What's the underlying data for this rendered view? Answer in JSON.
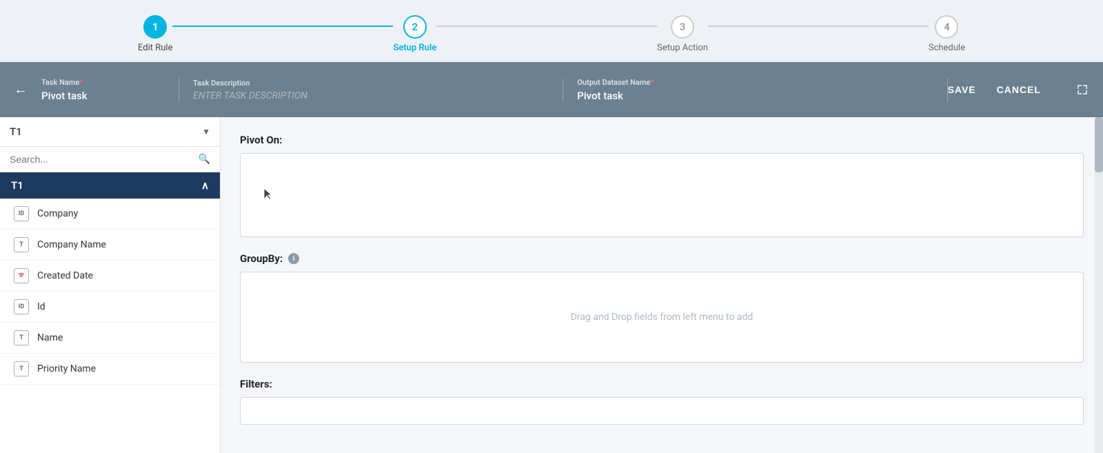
{
  "stepper": {
    "steps": [
      {
        "number": "1",
        "label": "Edit Rule",
        "state": "completed"
      },
      {
        "number": "2",
        "label": "Setup Rule",
        "state": "active"
      },
      {
        "number": "3",
        "label": "Setup Action",
        "state": "inactive"
      },
      {
        "number": "4",
        "label": "Schedule",
        "state": "inactive"
      }
    ]
  },
  "header": {
    "back_label": "←",
    "task_name_label": "Task Name",
    "task_name_required": "*",
    "task_name_value": "Pivot task",
    "task_description_label": "Task Description",
    "task_description_placeholder": "ENTER TASK DESCRIPTION",
    "output_dataset_label": "Output Dataset Name",
    "output_dataset_required": "*",
    "output_dataset_value": "Pivot task",
    "save_button": "SAVE",
    "cancel_button": "CANCEL"
  },
  "sidebar": {
    "dropdown_value": "T1",
    "search_placeholder": "Search...",
    "group_label": "T1",
    "items": [
      {
        "id": "company",
        "label": "Company",
        "icon": "ID"
      },
      {
        "id": "company-name",
        "label": "Company Name",
        "icon": "T"
      },
      {
        "id": "created-date",
        "label": "Created Date",
        "icon": "CAL"
      },
      {
        "id": "id",
        "label": "Id",
        "icon": "ID"
      },
      {
        "id": "name",
        "label": "Name",
        "icon": "T"
      },
      {
        "id": "priority-name",
        "label": "Priority Name",
        "icon": "T"
      }
    ]
  },
  "content": {
    "pivot_on_label": "Pivot On:",
    "groupby_label": "GroupBy:",
    "groupby_info": "i",
    "drag_drop_hint": "Drag and Drop fields from left menu to add",
    "filters_label": "Filters:"
  }
}
